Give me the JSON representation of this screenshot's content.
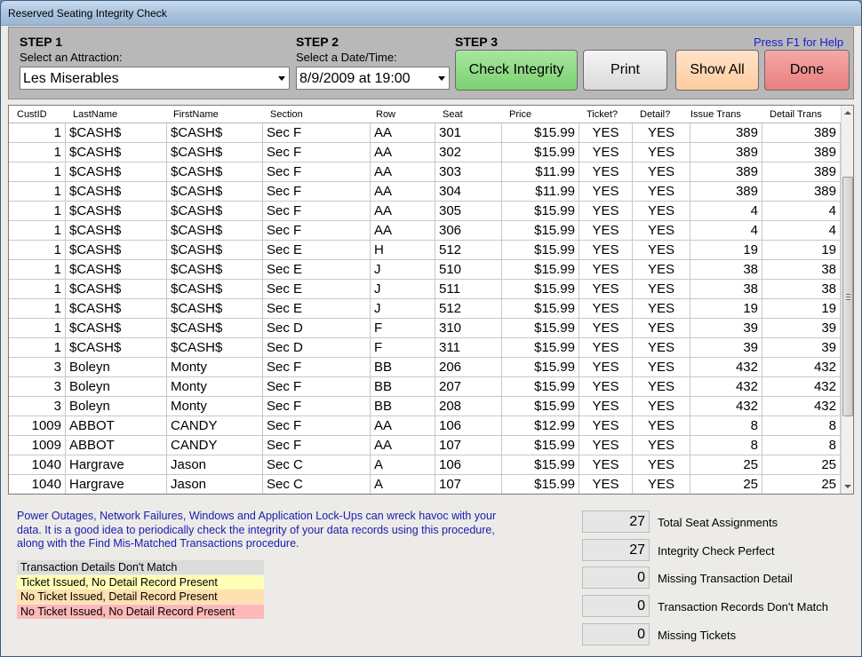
{
  "window": {
    "title": "Reserved Seating Integrity Check"
  },
  "steps": {
    "step1": {
      "heading": "STEP 1",
      "label": "Select an Attraction:",
      "value": "Les Miserables"
    },
    "step2": {
      "heading": "STEP 2",
      "label": "Select a Date/Time:",
      "value": "8/9/2009 at 19:00"
    },
    "step3": {
      "heading": "STEP 3"
    }
  },
  "help_link": "Press F1 for Help",
  "buttons": {
    "check": "Check Integrity",
    "print": "Print",
    "show_all": "Show All",
    "done": "Done"
  },
  "columns": [
    "CustID",
    "LastName",
    "FirstName",
    "Section",
    "Row",
    "Seat",
    "Price",
    "Ticket?",
    "Detail?",
    "Issue Trans",
    "Detail Trans"
  ],
  "rows": [
    [
      "1",
      "$CASH$",
      "$CASH$",
      "Sec F",
      "AA",
      "301",
      "$15.99",
      "YES",
      "YES",
      "389",
      "389"
    ],
    [
      "1",
      "$CASH$",
      "$CASH$",
      "Sec F",
      "AA",
      "302",
      "$15.99",
      "YES",
      "YES",
      "389",
      "389"
    ],
    [
      "1",
      "$CASH$",
      "$CASH$",
      "Sec F",
      "AA",
      "303",
      "$11.99",
      "YES",
      "YES",
      "389",
      "389"
    ],
    [
      "1",
      "$CASH$",
      "$CASH$",
      "Sec F",
      "AA",
      "304",
      "$11.99",
      "YES",
      "YES",
      "389",
      "389"
    ],
    [
      "1",
      "$CASH$",
      "$CASH$",
      "Sec F",
      "AA",
      "305",
      "$15.99",
      "YES",
      "YES",
      "4",
      "4"
    ],
    [
      "1",
      "$CASH$",
      "$CASH$",
      "Sec F",
      "AA",
      "306",
      "$15.99",
      "YES",
      "YES",
      "4",
      "4"
    ],
    [
      "1",
      "$CASH$",
      "$CASH$",
      "Sec E",
      "H",
      "512",
      "$15.99",
      "YES",
      "YES",
      "19",
      "19"
    ],
    [
      "1",
      "$CASH$",
      "$CASH$",
      "Sec E",
      "J",
      "510",
      "$15.99",
      "YES",
      "YES",
      "38",
      "38"
    ],
    [
      "1",
      "$CASH$",
      "$CASH$",
      "Sec E",
      "J",
      "511",
      "$15.99",
      "YES",
      "YES",
      "38",
      "38"
    ],
    [
      "1",
      "$CASH$",
      "$CASH$",
      "Sec E",
      "J",
      "512",
      "$15.99",
      "YES",
      "YES",
      "19",
      "19"
    ],
    [
      "1",
      "$CASH$",
      "$CASH$",
      "Sec D",
      "F",
      "310",
      "$15.99",
      "YES",
      "YES",
      "39",
      "39"
    ],
    [
      "1",
      "$CASH$",
      "$CASH$",
      "Sec D",
      "F",
      "311",
      "$15.99",
      "YES",
      "YES",
      "39",
      "39"
    ],
    [
      "3",
      "Boleyn",
      "Monty",
      "Sec F",
      "BB",
      "206",
      "$15.99",
      "YES",
      "YES",
      "432",
      "432"
    ],
    [
      "3",
      "Boleyn",
      "Monty",
      "Sec F",
      "BB",
      "207",
      "$15.99",
      "YES",
      "YES",
      "432",
      "432"
    ],
    [
      "3",
      "Boleyn",
      "Monty",
      "Sec F",
      "BB",
      "208",
      "$15.99",
      "YES",
      "YES",
      "432",
      "432"
    ],
    [
      "1009",
      "ABBOT",
      "CANDY",
      "Sec F",
      "AA",
      "106",
      "$12.99",
      "YES",
      "YES",
      "8",
      "8"
    ],
    [
      "1009",
      "ABBOT",
      "CANDY",
      "Sec F",
      "AA",
      "107",
      "$15.99",
      "YES",
      "YES",
      "8",
      "8"
    ],
    [
      "1040",
      "Hargrave",
      "Jason",
      "Sec C",
      "A",
      "106",
      "$15.99",
      "YES",
      "YES",
      "25",
      "25"
    ],
    [
      "1040",
      "Hargrave",
      "Jason",
      "Sec C",
      "A",
      "107",
      "$15.99",
      "YES",
      "YES",
      "25",
      "25"
    ]
  ],
  "info_text": "Power Outages, Network Failures, Windows and Application Lock-Ups can wreck havoc with your data.  It is a good idea to periodically check the integrity of your data records using this procedure, along with the Find Mis-Matched Transactions procedure.",
  "legend": [
    {
      "label": "Transaction Details Don't Match",
      "color": "#dcdcdc"
    },
    {
      "label": "Ticket Issued, No Detail Record Present",
      "color": "#ffffb8"
    },
    {
      "label": "No Ticket Issued, Detail Record Present",
      "color": "#ffe0b0"
    },
    {
      "label": "No Ticket Issued, No Detail Record Present",
      "color": "#ffb8b8"
    }
  ],
  "summary": [
    {
      "value": "27",
      "label": "Total Seat Assignments"
    },
    {
      "value": "27",
      "label": "Integrity Check Perfect"
    },
    {
      "value": "0",
      "label": "Missing Transaction Detail"
    },
    {
      "value": "0",
      "label": "Transaction Records Don't Match"
    },
    {
      "value": "0",
      "label": "Missing Tickets"
    }
  ]
}
